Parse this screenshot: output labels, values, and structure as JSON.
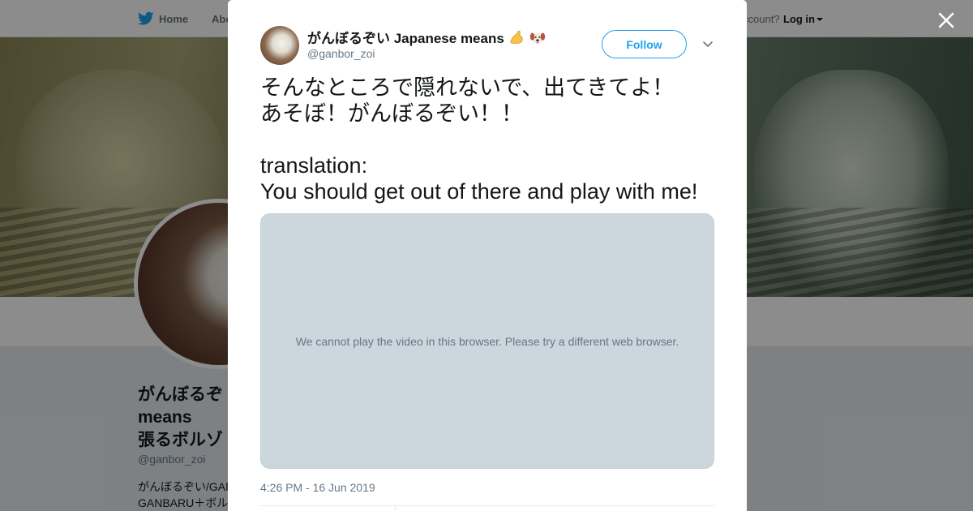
{
  "nav": {
    "home_label": "Home",
    "about_label": "Abo",
    "account_prompt": "ccount?",
    "login_label": "Log in"
  },
  "profile": {
    "name_lines": "がんぼるぞ\nmeans\n張るボルゾ",
    "handle": "@ganbor_zoi",
    "bio_snippet": "がんぼるぞい/GAN\nGANBARU＋ボル"
  },
  "tweet": {
    "author_name": "がんぼるぞい Japanese means",
    "author_handle": "@ganbor_zoi",
    "follow_label": "Follow",
    "text_line1": "そんなところで隠れないで、出てきてよ！\nあそぼ！がんぼるぞい！！",
    "text_line2": "translation:\nYou should get out of there and play with me!",
    "video_message": "We cannot play the video in this browser. Please try a different web browser.",
    "timestamp": "4:26 PM - 16 Jun 2019"
  },
  "icons": {
    "brand": "twitter-bird-icon",
    "close": "close-icon",
    "caret": "chevron-down-icon"
  },
  "colors": {
    "accent": "#1da1f2",
    "text_primary": "#14171a",
    "text_secondary": "#657786",
    "video_bg": "#ccd6dd"
  }
}
